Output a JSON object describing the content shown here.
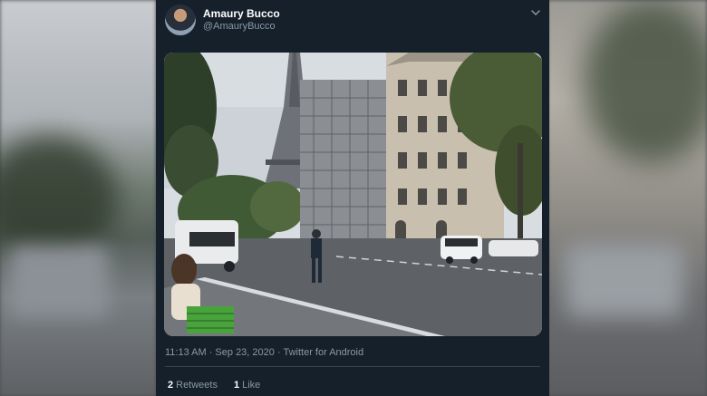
{
  "tweet": {
    "display_name": "Amaury Bucco",
    "handle": "@AmauryBucco",
    "timestamp": "11:13 AM · Sep 23, 2020 · Twitter for Android",
    "retweets_count": "2",
    "retweets_label": "Retweets",
    "likes_count": "1",
    "likes_label": "Like"
  },
  "icons": {
    "menu": "chevron-down-icon",
    "avatar": "profile-avatar"
  },
  "colors": {
    "card_bg": "#15202b",
    "secondary_text": "#8899a6",
    "divider": "#38444d"
  }
}
